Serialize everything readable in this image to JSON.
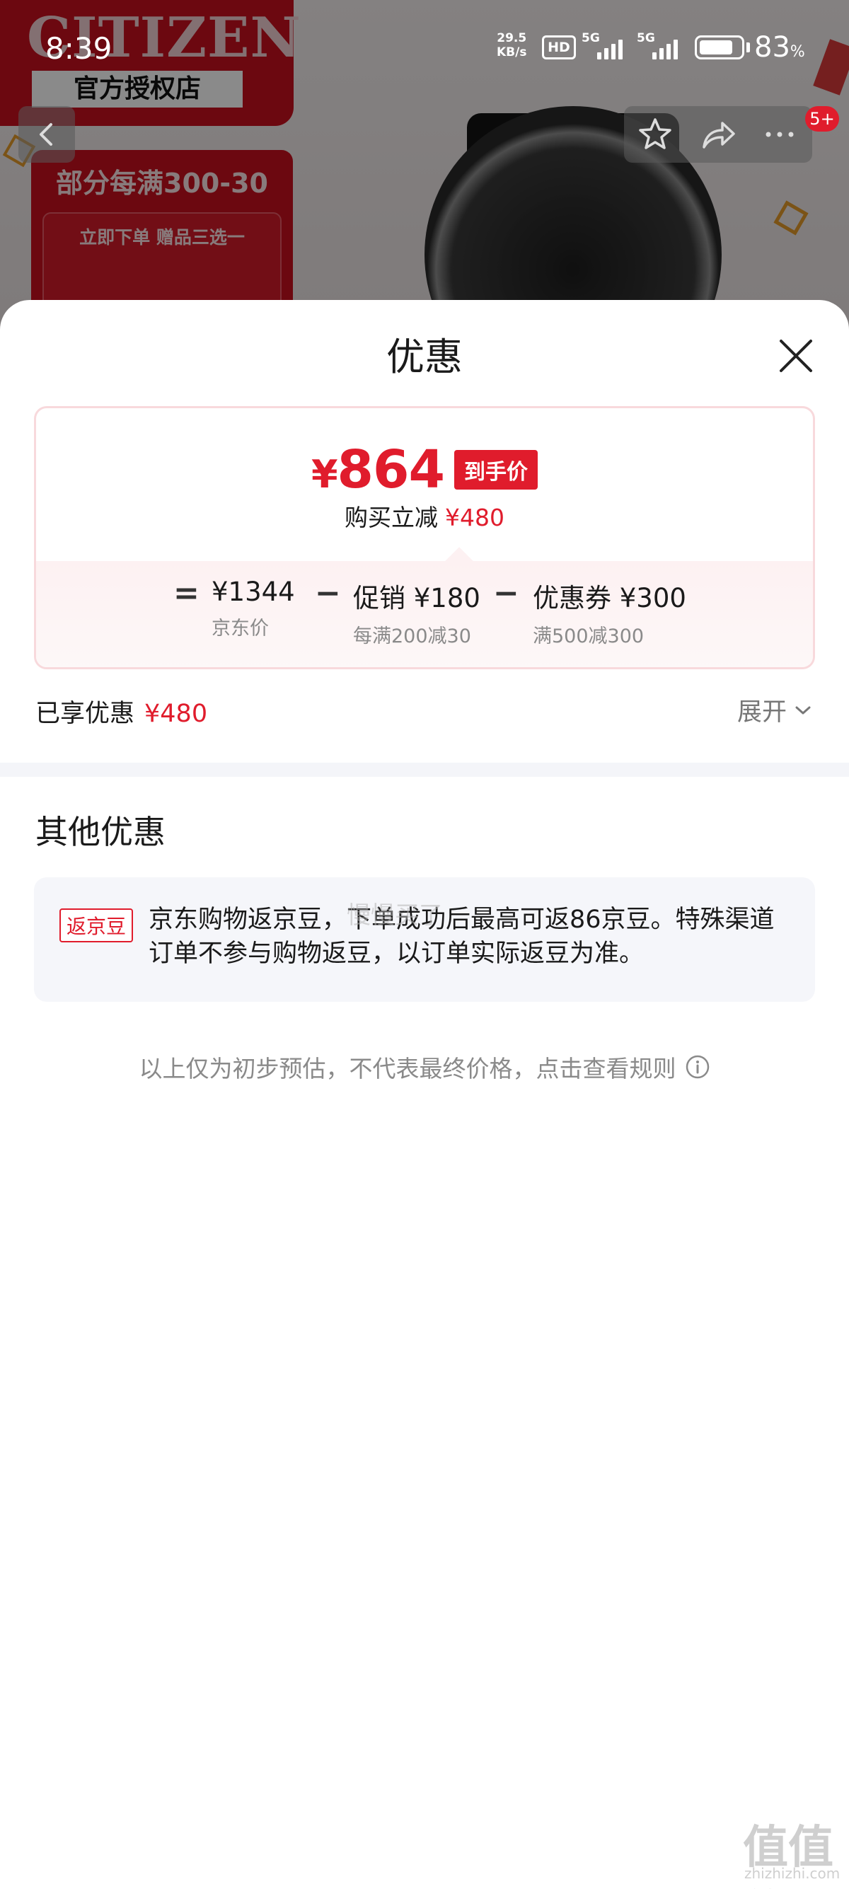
{
  "status_bar": {
    "time": "8:39",
    "net_speed_value": "29.5",
    "net_speed_unit": "KB/s",
    "hd_label": "HD",
    "signal1_label": "5G",
    "signal2_label": "5G",
    "battery_pct": "83",
    "battery_unit": "%",
    "battery_level": 0.83
  },
  "background_page": {
    "brand": "CITIZEN",
    "brand_subtitle": "官方授权店",
    "promo_title": "部分每满300-30",
    "promo_subtitle": "立即下单 赠品三选一",
    "cart_badge": "5+",
    "icons": [
      "back-icon",
      "star-icon",
      "share-icon",
      "more-icon"
    ]
  },
  "sheet": {
    "title": "优惠",
    "close_icon": "close-icon",
    "final_price": {
      "currency": "¥",
      "amount": "864",
      "tag": "到手价"
    },
    "instant_saving": {
      "label": "购买立减",
      "amount": "¥480"
    },
    "breakdown": {
      "equals": "=",
      "minus": "−",
      "items": [
        {
          "main": "¥1344",
          "sub": "京东价"
        },
        {
          "main": "促销 ¥180",
          "sub": "每满200减30"
        },
        {
          "main": "优惠券 ¥300",
          "sub": "满500减300"
        }
      ]
    },
    "enjoyed": {
      "label": "已享优惠",
      "amount": "¥480"
    },
    "expand_label": "展开",
    "other_section_title": "其他优惠",
    "bean": {
      "tag": "返京豆",
      "text": "京东购物返京豆，下单成功后最高可返86京豆。特殊渠道订单不参与购物返豆，以订单实际返豆为准。"
    },
    "disclaimer": "以上仅为初步预估，不代表最终价格，点击查看规则"
  },
  "watermarks": {
    "center": "慢慢买了",
    "corner": "值值值",
    "corner_url": "zhizhizhi.com"
  },
  "colors": {
    "accent_red": "#e01c2c",
    "sheet_bg": "#ffffff",
    "card_border": "#f8d9dc",
    "muted_text": "#8a8a8a"
  }
}
